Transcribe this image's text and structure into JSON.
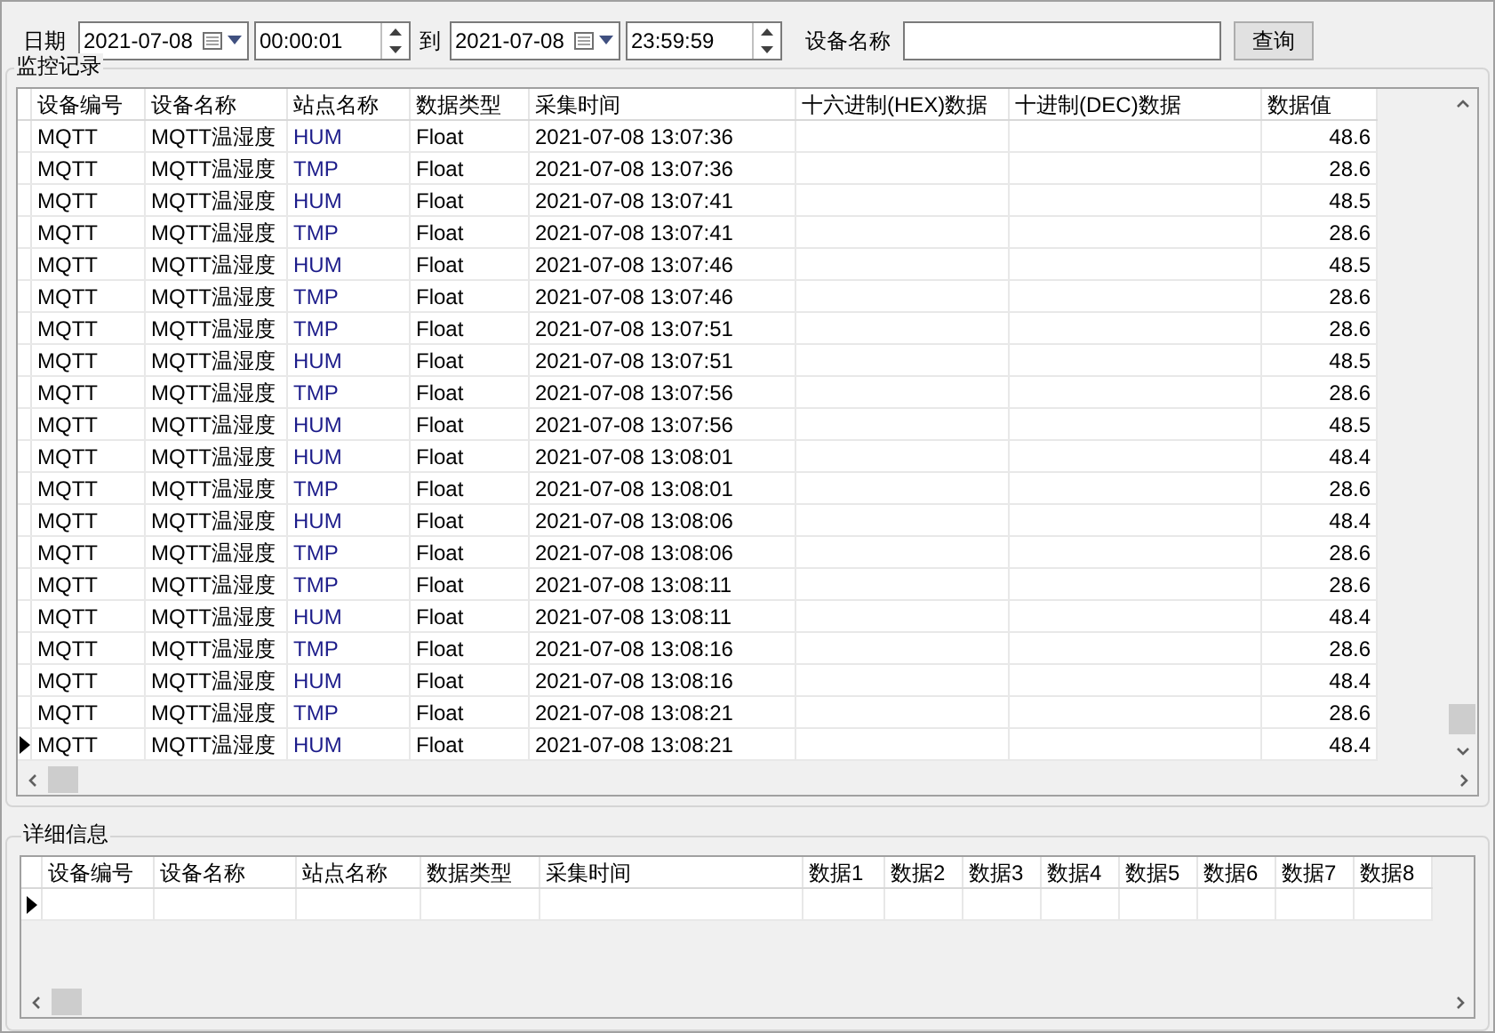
{
  "filter": {
    "date_label": "日期",
    "start_date": "2021-07-08",
    "start_time": "00:00:01",
    "to_label": "到",
    "end_date": "2021-07-08",
    "end_time": "23:59:59",
    "device_label": "设备名称",
    "query_button": "查询"
  },
  "monitor": {
    "title": "监控记录",
    "columns": [
      "设备编号",
      "设备名称",
      "站点名称",
      "数据类型",
      "采集时间",
      "十六进制(HEX)数据",
      "十进制(DEC)数据",
      "数据值"
    ],
    "rows": [
      {
        "cells": [
          "MQTT",
          "MQTT温湿度",
          "HUM",
          "Float",
          "2021-07-08 13:07:36",
          "",
          "",
          "48.6"
        ],
        "current": false
      },
      {
        "cells": [
          "MQTT",
          "MQTT温湿度",
          "TMP",
          "Float",
          "2021-07-08 13:07:36",
          "",
          "",
          "28.6"
        ],
        "current": false
      },
      {
        "cells": [
          "MQTT",
          "MQTT温湿度",
          "HUM",
          "Float",
          "2021-07-08 13:07:41",
          "",
          "",
          "48.5"
        ],
        "current": false
      },
      {
        "cells": [
          "MQTT",
          "MQTT温湿度",
          "TMP",
          "Float",
          "2021-07-08 13:07:41",
          "",
          "",
          "28.6"
        ],
        "current": false
      },
      {
        "cells": [
          "MQTT",
          "MQTT温湿度",
          "HUM",
          "Float",
          "2021-07-08 13:07:46",
          "",
          "",
          "48.5"
        ],
        "current": false
      },
      {
        "cells": [
          "MQTT",
          "MQTT温湿度",
          "TMP",
          "Float",
          "2021-07-08 13:07:46",
          "",
          "",
          "28.6"
        ],
        "current": false
      },
      {
        "cells": [
          "MQTT",
          "MQTT温湿度",
          "TMP",
          "Float",
          "2021-07-08 13:07:51",
          "",
          "",
          "28.6"
        ],
        "current": false
      },
      {
        "cells": [
          "MQTT",
          "MQTT温湿度",
          "HUM",
          "Float",
          "2021-07-08 13:07:51",
          "",
          "",
          "48.5"
        ],
        "current": false
      },
      {
        "cells": [
          "MQTT",
          "MQTT温湿度",
          "TMP",
          "Float",
          "2021-07-08 13:07:56",
          "",
          "",
          "28.6"
        ],
        "current": false
      },
      {
        "cells": [
          "MQTT",
          "MQTT温湿度",
          "HUM",
          "Float",
          "2021-07-08 13:07:56",
          "",
          "",
          "48.5"
        ],
        "current": false
      },
      {
        "cells": [
          "MQTT",
          "MQTT温湿度",
          "HUM",
          "Float",
          "2021-07-08 13:08:01",
          "",
          "",
          "48.4"
        ],
        "current": false
      },
      {
        "cells": [
          "MQTT",
          "MQTT温湿度",
          "TMP",
          "Float",
          "2021-07-08 13:08:01",
          "",
          "",
          "28.6"
        ],
        "current": false
      },
      {
        "cells": [
          "MQTT",
          "MQTT温湿度",
          "HUM",
          "Float",
          "2021-07-08 13:08:06",
          "",
          "",
          "48.4"
        ],
        "current": false
      },
      {
        "cells": [
          "MQTT",
          "MQTT温湿度",
          "TMP",
          "Float",
          "2021-07-08 13:08:06",
          "",
          "",
          "28.6"
        ],
        "current": false
      },
      {
        "cells": [
          "MQTT",
          "MQTT温湿度",
          "TMP",
          "Float",
          "2021-07-08 13:08:11",
          "",
          "",
          "28.6"
        ],
        "current": false
      },
      {
        "cells": [
          "MQTT",
          "MQTT温湿度",
          "HUM",
          "Float",
          "2021-07-08 13:08:11",
          "",
          "",
          "48.4"
        ],
        "current": false
      },
      {
        "cells": [
          "MQTT",
          "MQTT温湿度",
          "TMP",
          "Float",
          "2021-07-08 13:08:16",
          "",
          "",
          "28.6"
        ],
        "current": false
      },
      {
        "cells": [
          "MQTT",
          "MQTT温湿度",
          "HUM",
          "Float",
          "2021-07-08 13:08:16",
          "",
          "",
          "48.4"
        ],
        "current": false
      },
      {
        "cells": [
          "MQTT",
          "MQTT温湿度",
          "TMP",
          "Float",
          "2021-07-08 13:08:21",
          "",
          "",
          "28.6"
        ],
        "current": false
      },
      {
        "cells": [
          "MQTT",
          "MQTT温湿度",
          "HUM",
          "Float",
          "2021-07-08 13:08:21",
          "",
          "",
          "48.4"
        ],
        "current": true
      }
    ]
  },
  "detail": {
    "title": "详细信息",
    "columns": [
      "设备编号",
      "设备名称",
      "站点名称",
      "数据类型",
      "采集时间",
      "数据1",
      "数据2",
      "数据3",
      "数据4",
      "数据5",
      "数据6",
      "数据7",
      "数据8"
    ],
    "rows": [
      {
        "current": true
      }
    ]
  }
}
